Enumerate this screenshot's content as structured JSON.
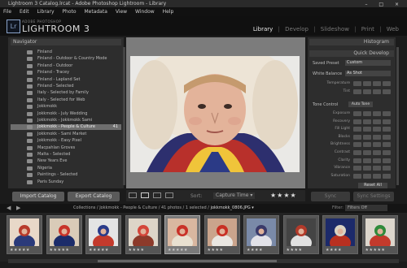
{
  "window": {
    "title": "Lightroom 3 Catalog.lrcat - Adobe Photoshop Lightroom - Library",
    "controls": "– □ ×"
  },
  "menu": [
    "File",
    "Edit",
    "Library",
    "Photo",
    "Metadata",
    "View",
    "Window",
    "Help"
  ],
  "identity": {
    "badge": "Lr",
    "brand_small": "ADOBE PHOTOSHOP",
    "brand_big": "LIGHTROOM 3"
  },
  "modules": [
    "Library",
    "Develop",
    "Slideshow",
    "Print",
    "Web"
  ],
  "separator": "|",
  "left_panel": {
    "header": "Navigator",
    "collections": [
      {
        "name": "Finland",
        "count": ""
      },
      {
        "name": "Finland - Outdoor & Country Mode",
        "count": ""
      },
      {
        "name": "Finland - Outdoor",
        "count": ""
      },
      {
        "name": "Finland - Tracey",
        "count": ""
      },
      {
        "name": "Finland - Lapland Set",
        "count": ""
      },
      {
        "name": "Finland - Selected",
        "count": ""
      },
      {
        "name": "Italy - Selected by Family",
        "count": ""
      },
      {
        "name": "Italy - Selected for Web",
        "count": ""
      },
      {
        "name": "Jokkmokk",
        "count": ""
      },
      {
        "name": "Jokkmokk - July Wedding",
        "count": ""
      },
      {
        "name": "Jokkmokk - Jokkmokk Sami",
        "count": ""
      },
      {
        "name": "Jokkmokk - People & Culture",
        "count": "41"
      },
      {
        "name": "Jokkmokk - Sami Market",
        "count": ""
      },
      {
        "name": "Jokkmokk - Easy Pixel",
        "count": ""
      },
      {
        "name": "Macpahlan Groves",
        "count": ""
      },
      {
        "name": "Malta - Selected",
        "count": ""
      },
      {
        "name": "New Years Eve",
        "count": ""
      },
      {
        "name": "Nigeria",
        "count": ""
      },
      {
        "name": "Paintings - Selected",
        "count": ""
      },
      {
        "name": "Paris Sunday",
        "count": ""
      }
    ],
    "import_label": "Import Catalog",
    "export_label": "Export Catalog"
  },
  "toolbar": {
    "sort_label": "Sort:",
    "sort_value": "Capture Time ▾",
    "stars": "★★★★"
  },
  "right_panel": {
    "histogram": "Histogram",
    "quick_develop": "Quick Develop",
    "saved_preset_label": "Saved Preset",
    "saved_preset_value": "Custom",
    "white_balance_label": "White Balance",
    "white_balance_value": "As Shot",
    "wb_rows": [
      "Temperature",
      "Tint"
    ],
    "tone_control": "Tone Control",
    "auto_tone": "Auto Tone",
    "tone_rows": [
      "Exposure",
      "Recovery",
      "Fill Light",
      "Blacks",
      "Brightness",
      "Contrast",
      "Clarity",
      "Vibrance",
      "Saturation"
    ],
    "reset_all": "Reset All",
    "sync_label": "Sync",
    "sync_settings_label": "Sync Settings"
  },
  "filmstrip": {
    "path_prefix": "Collections / Jokkmokk - People & Culture / 41 photos / 1 selected /",
    "path_file": "jokkmokk_0806.JPG ▾",
    "filter_label": "Filter:",
    "filter_value": "Filters Off",
    "thumbs": [
      {
        "stars": "★★★★★",
        "c1": "#b83a2b",
        "c2": "#2b3a7a",
        "c3": "#e8d8c8"
      },
      {
        "stars": "★★★★★",
        "c1": "#c8342a",
        "c2": "#1c2c6a",
        "c3": "#d9cbb8"
      },
      {
        "stars": "★★★★★",
        "c1": "#2a3b8a",
        "c2": "#c33a2c",
        "c3": "#e4e4e4"
      },
      {
        "stars": "★★★★",
        "c1": "#d4463a",
        "c2": "#8c3a2a",
        "c3": "#ddd5c8"
      },
      {
        "stars": "★★★★★",
        "c1": "#c93128",
        "c2": "#e8e0d0",
        "c3": "#d9b7a0"
      },
      {
        "stars": "★★★★",
        "c1": "#c82f24",
        "c2": "#e9e6e1",
        "c3": "#caa48c"
      },
      {
        "stars": "★★★★",
        "c1": "#3a3a6a",
        "c2": "#e2e2e8",
        "c3": "#7a8aa8"
      },
      {
        "stars": "★★★★",
        "c1": "#b23a2a",
        "c2": "#e0e0e0",
        "c3": "#444"
      },
      {
        "stars": "★★★★",
        "c1": "#d9d2c2",
        "c2": "#b83020",
        "c3": "#1c2a6a"
      },
      {
        "stars": "★★★★★",
        "c1": "#2f8a3a",
        "c2": "#c33a2c",
        "c3": "#dcd6cc"
      }
    ]
  }
}
